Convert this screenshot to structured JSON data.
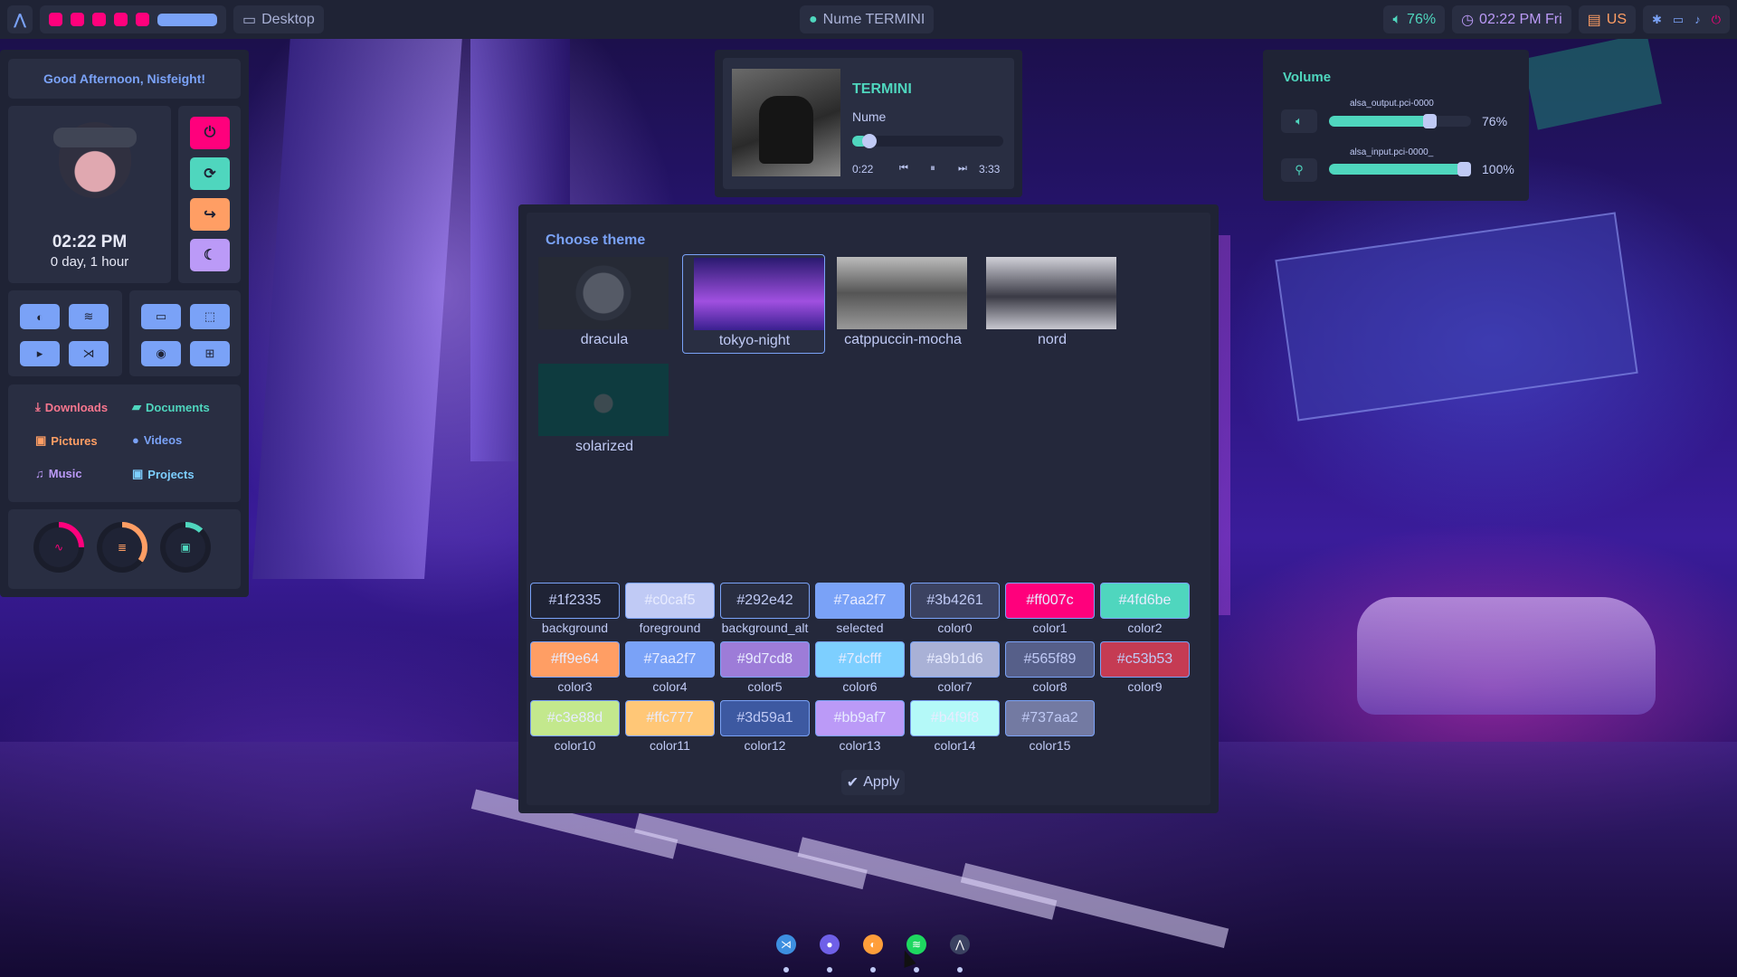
{
  "topbar": {
    "logo": "⋀",
    "window_label": "Desktop",
    "media_label": "Nume TERMINI",
    "volume_text": "76%",
    "clock_text": "02:22 PM Fri",
    "keyboard_layout": "US",
    "workspace_colors": [
      "#ff007c",
      "#ff007c",
      "#ff007c",
      "#ff007c",
      "#ff007c"
    ]
  },
  "dashboard": {
    "greeting": "Good Afternoon, Nisfeight!",
    "time": "02:22 PM",
    "uptime": "0 day, 1 hour",
    "power_buttons": [
      {
        "icon": "power-icon",
        "glyph": "⏻",
        "color": "#ff007c"
      },
      {
        "icon": "refresh-icon",
        "glyph": "⟳",
        "color": "#4fd6be"
      },
      {
        "icon": "logout-icon",
        "glyph": "↪",
        "color": "#ff9e64"
      },
      {
        "icon": "moon-icon",
        "glyph": "☾",
        "color": "#bb9af7"
      }
    ],
    "app_buttons_left": [
      {
        "icon": "firefox-icon",
        "glyph": "◐"
      },
      {
        "icon": "spotify-icon",
        "glyph": "≋"
      },
      {
        "icon": "terminal-icon",
        "glyph": "▸"
      },
      {
        "icon": "vscode-icon",
        "glyph": "⋊"
      }
    ],
    "app_buttons_right": [
      {
        "icon": "monitor-icon",
        "glyph": "▭"
      },
      {
        "icon": "screenshot-icon",
        "glyph": "⬚"
      },
      {
        "icon": "record-icon",
        "glyph": "◉"
      },
      {
        "icon": "apps-grid-icon",
        "glyph": "⊞"
      }
    ],
    "folders": [
      {
        "label": "Downloads",
        "glyph": "⤓",
        "color": "#f7768e"
      },
      {
        "label": "Documents",
        "glyph": "▰",
        "color": "#4fd6be"
      },
      {
        "label": "Pictures",
        "glyph": "▣",
        "color": "#ff9e64"
      },
      {
        "label": "Videos",
        "glyph": "●",
        "color": "#7aa2f7"
      },
      {
        "label": "Music",
        "glyph": "♫",
        "color": "#bb9af7"
      },
      {
        "label": "Projects",
        "glyph": "▣",
        "color": "#7dcfff"
      }
    ],
    "gauges": [
      {
        "name": "cpu",
        "glyph": "∿",
        "color": "#ff007c",
        "fraction": 0.25
      },
      {
        "name": "memory",
        "glyph": "≣",
        "color": "#ff9e64",
        "fraction": 0.35
      },
      {
        "name": "disk",
        "glyph": "▣",
        "color": "#4fd6be",
        "fraction": 0.12
      }
    ]
  },
  "player": {
    "title": "TERMINI",
    "artist": "Nume",
    "elapsed": "0:22",
    "total": "3:33",
    "progress": 0.1
  },
  "volume": {
    "title": "Volume",
    "output_device": "alsa_output.pci-0000",
    "output_percent": "76%",
    "output_level": 0.76,
    "input_device": "alsa_input.pci-0000_",
    "input_percent": "100%",
    "input_level": 1.0
  },
  "theme_panel": {
    "title": "Choose theme",
    "themes": [
      {
        "name": "dracula",
        "selected": false
      },
      {
        "name": "tokyo-night",
        "selected": true
      },
      {
        "name": "catppuccin-mocha",
        "selected": false
      },
      {
        "name": "nord",
        "selected": false
      },
      {
        "name": "solarized",
        "selected": false
      }
    ],
    "colors": [
      {
        "label": "background",
        "hex": "#1f2335"
      },
      {
        "label": "foreground",
        "hex": "#c0caf5"
      },
      {
        "label": "background_alt",
        "hex": "#292e42"
      },
      {
        "label": "selected",
        "hex": "#7aa2f7"
      },
      {
        "label": "color0",
        "hex": "#3b4261"
      },
      {
        "label": "color1",
        "hex": "#ff007c"
      },
      {
        "label": "color2",
        "hex": "#4fd6be"
      },
      {
        "label": "color3",
        "hex": "#ff9e64"
      },
      {
        "label": "color4",
        "hex": "#7aa2f7"
      },
      {
        "label": "color5",
        "hex": "#9d7cd8"
      },
      {
        "label": "color6",
        "hex": "#7dcfff"
      },
      {
        "label": "color7",
        "hex": "#a9b1d6"
      },
      {
        "label": "color8",
        "hex": "#565f89"
      },
      {
        "label": "color9",
        "hex": "#c53b53"
      },
      {
        "label": "color10",
        "hex": "#c3e88d"
      },
      {
        "label": "color11",
        "hex": "#ffc777"
      },
      {
        "label": "color12",
        "hex": "#3d59a1"
      },
      {
        "label": "color13",
        "hex": "#bb9af7"
      },
      {
        "label": "color14",
        "hex": "#b4f9f8"
      },
      {
        "label": "color15",
        "hex": "#737aa2"
      }
    ],
    "apply_label": "Apply"
  },
  "dock": [
    {
      "name": "vscode",
      "color": "#3d8fe0"
    },
    {
      "name": "discord",
      "color": "#6f60e8"
    },
    {
      "name": "firefox",
      "color": "#ff9e3a"
    },
    {
      "name": "spotify",
      "color": "#1ed760"
    },
    {
      "name": "launcher",
      "color": "#3b4261"
    }
  ]
}
